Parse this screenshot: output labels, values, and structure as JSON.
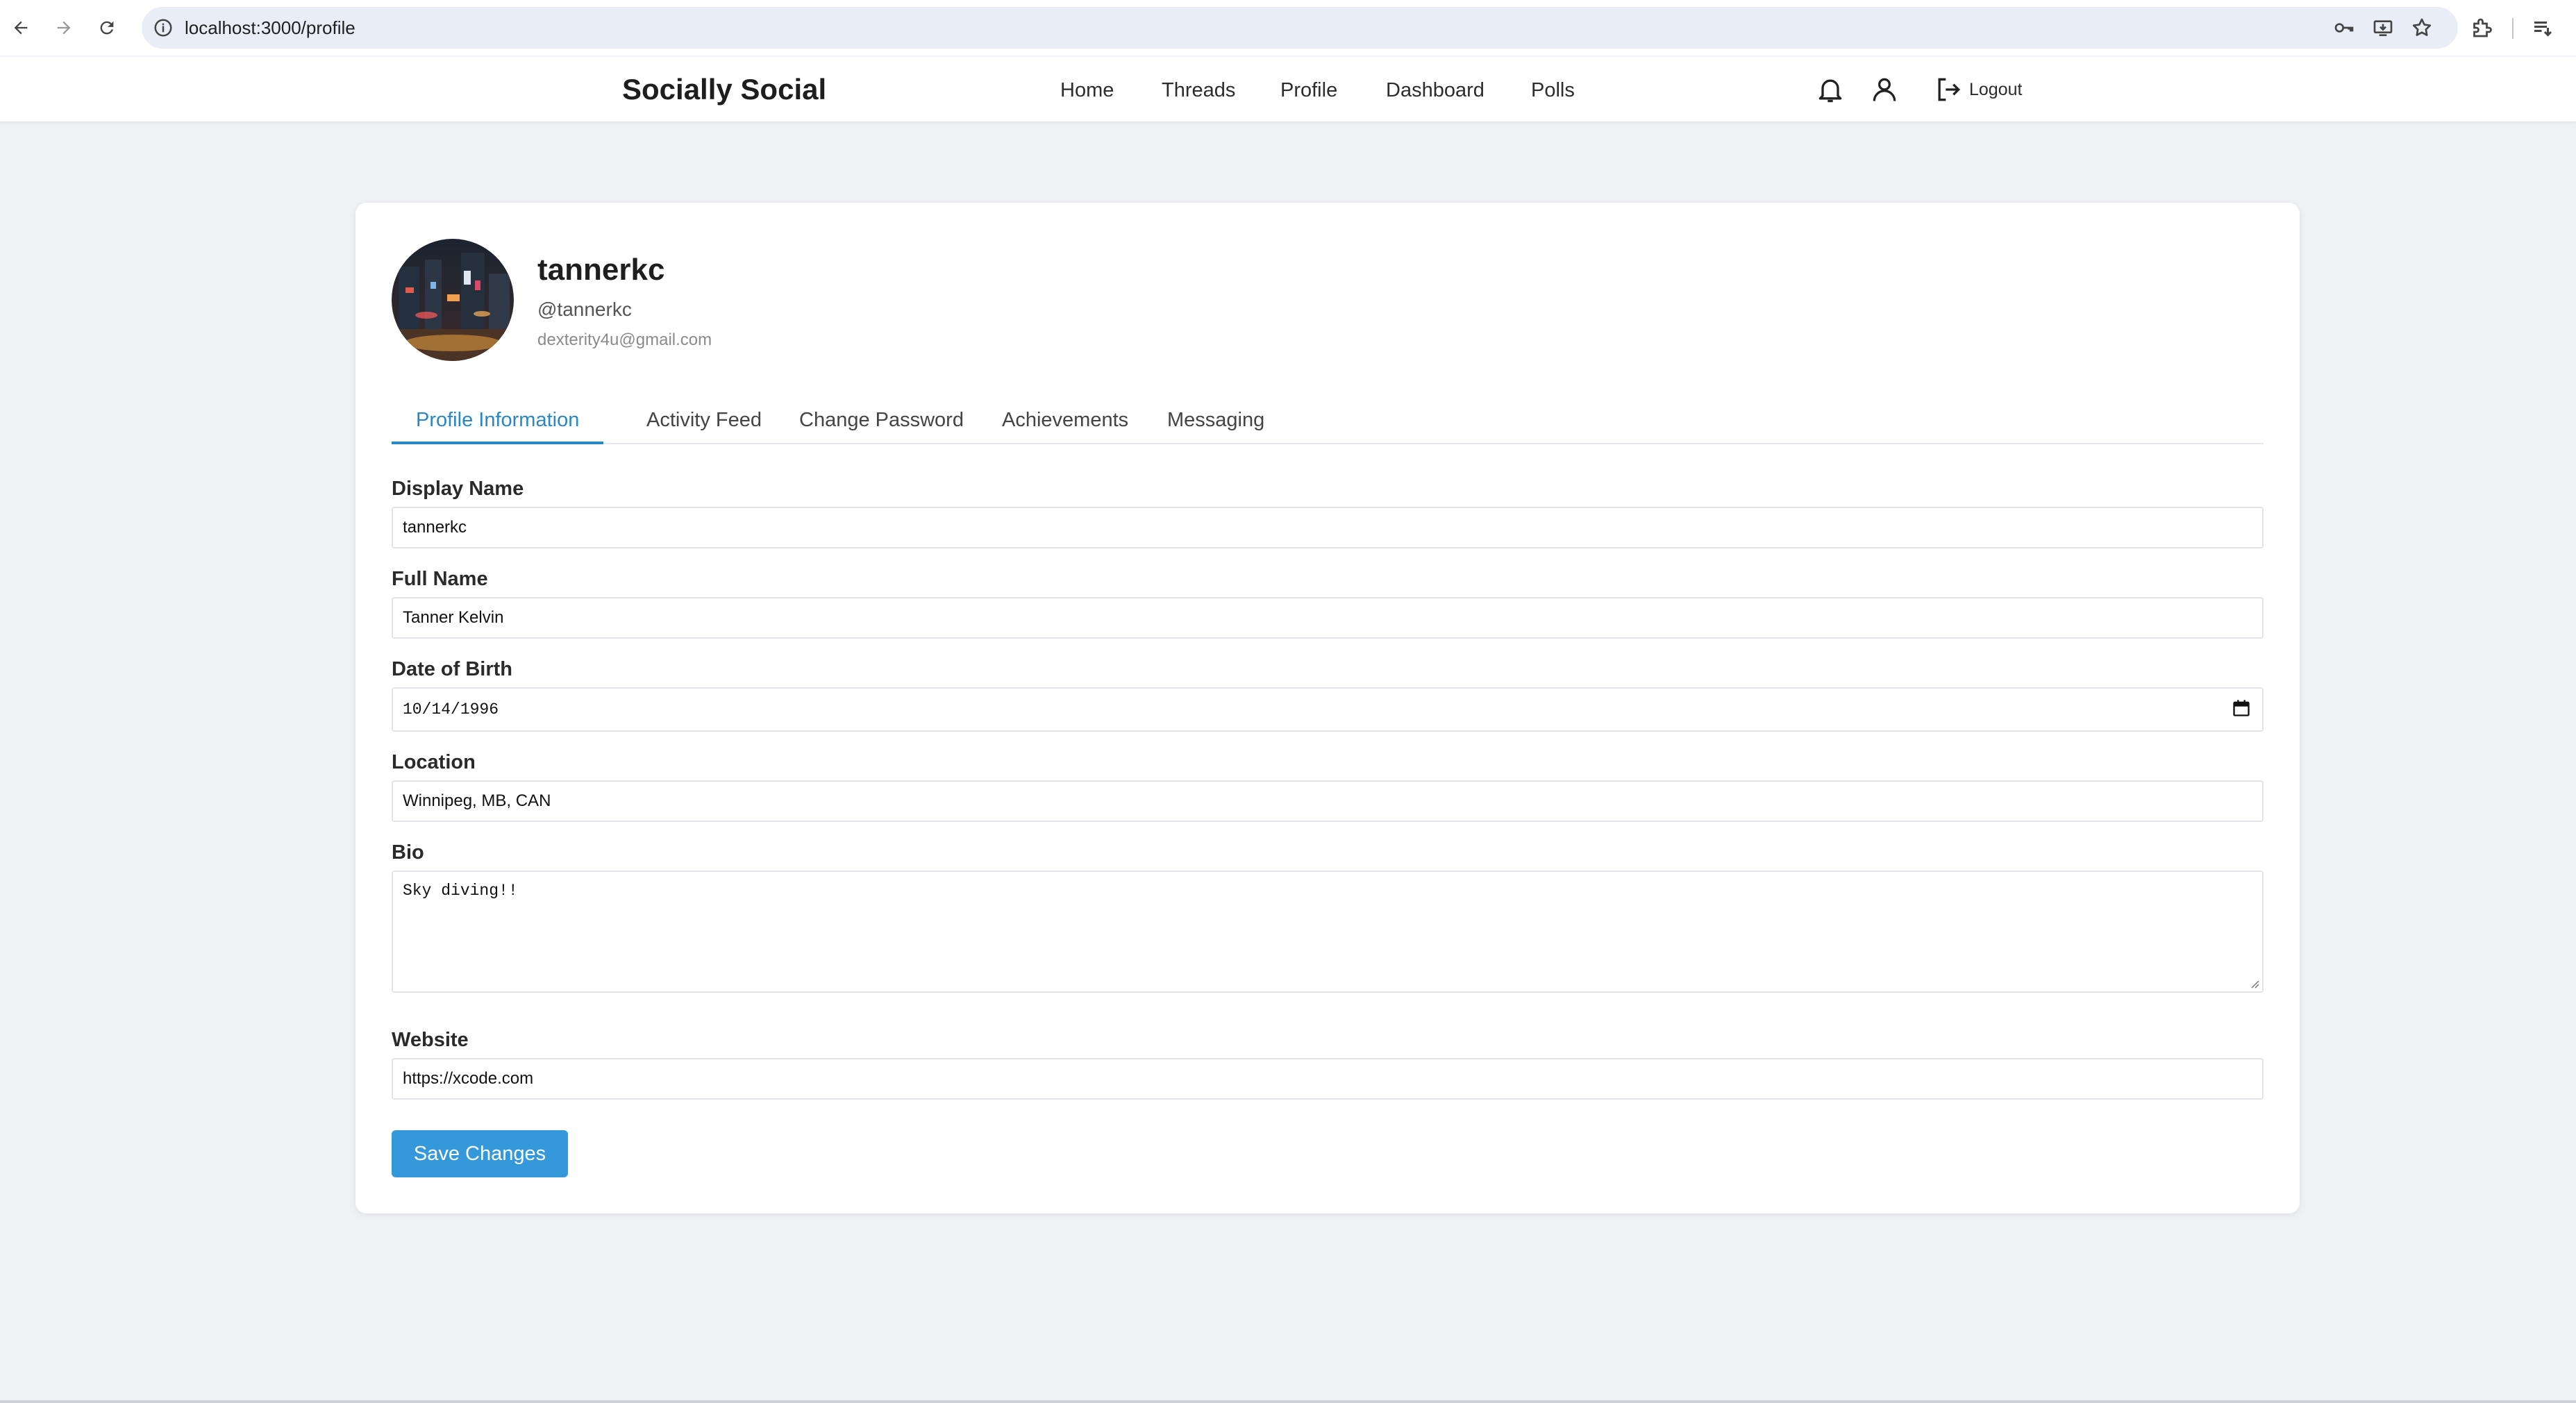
{
  "browser": {
    "url": "localhost:3000/profile"
  },
  "header": {
    "brand": "Socially Social",
    "nav": [
      "Home",
      "Threads",
      "Profile",
      "Dashboard",
      "Polls"
    ],
    "logout_label": "Logout"
  },
  "profile": {
    "username": "tannerkc",
    "handle": "@tannerkc",
    "email": "dexterity4u@gmail.com"
  },
  "tabs": [
    "Profile Information",
    "Activity Feed",
    "Change Password",
    "Achievements",
    "Messaging"
  ],
  "form": {
    "display_name_label": "Display Name",
    "display_name_value": "tannerkc",
    "full_name_label": "Full Name",
    "full_name_value": "Tanner Kelvin",
    "dob_label": "Date of Birth",
    "dob_value": "10/14/1996",
    "location_label": "Location",
    "location_value": "Winnipeg, MB, CAN",
    "bio_label": "Bio",
    "bio_value": "Sky diving!!",
    "website_label": "Website",
    "website_value": "https://xcode.com",
    "save_label": "Save Changes"
  },
  "colors": {
    "accent": "#2b86c5",
    "button": "#3498db",
    "background": "#eff1f5"
  }
}
